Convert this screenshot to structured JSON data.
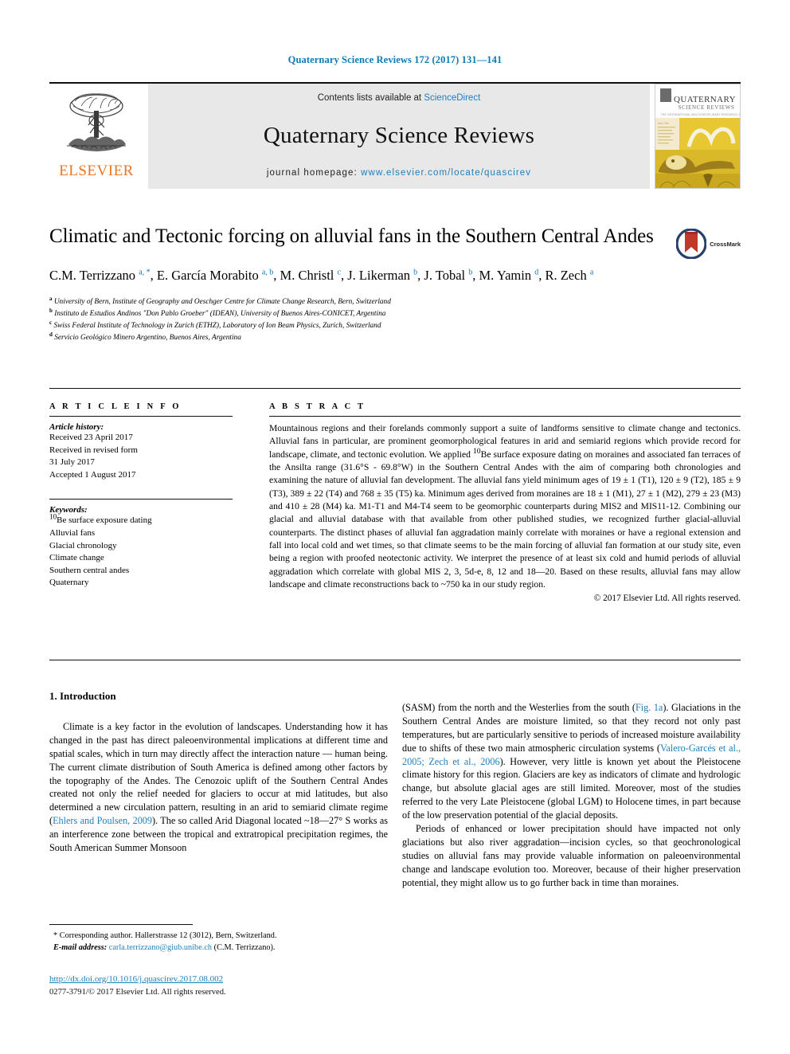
{
  "running_head": "Quaternary Science Reviews 172 (2017) 131—141",
  "masthead": {
    "publisher_name": "ELSEVIER",
    "contents_prefix": "Contents lists available at ",
    "contents_link": "ScienceDirect",
    "journal_name": "Quaternary Science Reviews",
    "homepage_prefix": "journal homepage: ",
    "homepage_url": "www.elsevier.com/locate/quascirev",
    "cover_title_line1": "QUATERNARY",
    "cover_title_line2": "SCIENCE REVIEWS",
    "cover_subtitle": "THE INTERNATIONAL MULTIDISCIPLINARY RESEARCH AND REVIEW JOURNAL"
  },
  "article": {
    "title": "Climatic and Tectonic forcing on alluvial fans in the Southern Central Andes",
    "crossmark_label": "CrossMark",
    "authors_html": "C.M. Terrizzano <sup>a, *</sup>, E. García Morabito <sup>a, b</sup>, M. Christl <sup>c</sup>, J. Likerman <sup>b</sup>, J. Tobal <sup>b</sup>, M. Yamin <sup>d</sup>, R. Zech <sup>a</sup>",
    "affiliations": [
      {
        "marker": "a",
        "text": "University of Bern, Institute of Geography and Oeschger Centre for Climate Change Research, Bern, Switzerland"
      },
      {
        "marker": "b",
        "text": "Instituto de Estudios Andinos \"Don Pablo Groeber\" (IDEAN), University of Buenos Aires-CONICET, Argentina"
      },
      {
        "marker": "c",
        "text": "Swiss Federal Institute of Technology in Zurich (ETHZ), Laboratory of Ion Beam Physics, Zurich, Switzerland"
      },
      {
        "marker": "d",
        "text": "Servicio Geológico Minero Argentino, Buenos Aires, Argentina"
      }
    ]
  },
  "article_info": {
    "heading": "A R T I C L E  I N F O",
    "history_label": "Article history:",
    "history": [
      "Received 23 April 2017",
      "Received in revised form",
      "31 July 2017",
      "Accepted 1 August 2017"
    ],
    "keywords_label": "Keywords:",
    "keywords_html": [
      "<sup>10</sup>Be surface exposure dating",
      "Alluvial fans",
      "Glacial chronology",
      "Climate change",
      "Southern central andes",
      "Quaternary"
    ]
  },
  "abstract": {
    "heading": "A B S T R A C T",
    "body_html": "Mountainous regions and their forelands commonly support a suite of landforms sensitive to climate change and tectonics. Alluvial fans in particular, are prominent geomorphological features in arid and semiarid regions which provide record for landscape, climate, and tectonic evolution. We applied <sup>10</sup>Be surface exposure dating on moraines and associated fan terraces of the Ansilta range (31.6°S - 69.8°W) in the Southern Central Andes with the aim of comparing both chronologies and examining the nature of alluvial fan development. The alluvial fans yield minimum ages of 19 ± 1 (T1), 120 ± 9 (T2), 185 ± 9 (T3), 389 ± 22 (T4) and 768 ± 35 (T5) ka. Minimum ages derived from moraines are 18 ± 1 (M1), 27 ± 1 (M2), 279 ± 23 (M3) and 410 ± 28 (M4) ka. M1-T1 and M4-T4 seem to be geomorphic counterparts during MIS2 and MIS11-12. Combining our glacial and alluvial database with that available from other published studies, we recognized further glacial-alluvial counterparts. The distinct phases of alluvial fan aggradation mainly correlate with moraines or have a regional extension and fall into local cold and wet times, so that climate seems to be the main forcing of alluvial fan formation at our study site, even being a region with proofed neotectonic activity. We interpret the presence of at least six cold and humid periods of alluvial aggradation which correlate with global MIS 2, 3, 5d-e, 8, 12 and 18—20. Based on these results, alluvial fans may allow landscape and climate reconstructions back to ~750 ka in our study region.",
    "copyright": "© 2017 Elsevier Ltd. All rights reserved."
  },
  "introduction": {
    "heading": "1. Introduction",
    "left_paragraph_html": "Climate is a key factor in the evolution of landscapes. Understanding how it has changed in the past has direct paleoenvironmental implications at different time and spatial scales, which in turn may directly affect the interaction nature — human being. The current climate distribution of South America is defined among other factors by the topography of the Andes. The Cenozoic uplift of the Southern Central Andes created not only the relief needed for glaciers to occur at mid latitudes, but also determined a new circulation pattern, resulting in an arid to semiarid climate regime (<span class=\"lnk\">Ehlers and Poulsen, 2009</span>). The so called Arid Diagonal located ~18—27° S works as an interference zone between the tropical and extratropical precipitation regimes, the South American Summer Monsoon",
    "right_paragraph_1_html": "(SASM) from the north and the Westerlies from the south (<span class=\"lnk\">Fig. 1a</span>). Glaciations in the Southern Central Andes are moisture limited, so that they record not only past temperatures, but are particularly sensitive to periods of increased moisture availability due to shifts of these two main atmospheric circulation systems (<span class=\"lnk\">Valero-Garcés et al., 2005; Zech et al., 2006</span>). However, very little is known yet about the Pleistocene climate history for this region. Glaciers are key as indicators of climate and hydrologic change, but absolute glacial ages are still limited. Moreover, most of the studies referred to the very Late Pleistocene (global LGM) to Holocene times, in part because of the low preservation potential of the glacial deposits.",
    "right_paragraph_2_html": "Periods of enhanced or lower precipitation should have impacted not only glaciations but also river aggradation—incision cycles, so that geochronological studies on alluvial fans may provide valuable information on paleoenvironmental change and landscape evolution too. Moreover, because of their higher preservation potential, they might allow us to go further back in time than moraines."
  },
  "footer": {
    "corresponding_html": "* Corresponding author. Hallerstrasse 12 (3012), Bern, Switzerland.",
    "email_label": "E-mail address:",
    "email": "carla.terrizzano@giub.unibe.ch",
    "email_owner": "(C.M. Terrizzano).",
    "doi": "http://dx.doi.org/10.1016/j.quascirev.2017.08.002",
    "issn_line": "0277-3791/© 2017 Elsevier Ltd. All rights reserved."
  },
  "colors": {
    "link_blue": "#1f7fb8",
    "header_blue": "#0b7bb5",
    "elsevier_orange": "#E87722",
    "masthead_grey": "#e8e8e8",
    "crossmark_red": "#c0392b",
    "crossmark_blue": "#2b3f6c",
    "cover_yellow": "#e8c832"
  }
}
